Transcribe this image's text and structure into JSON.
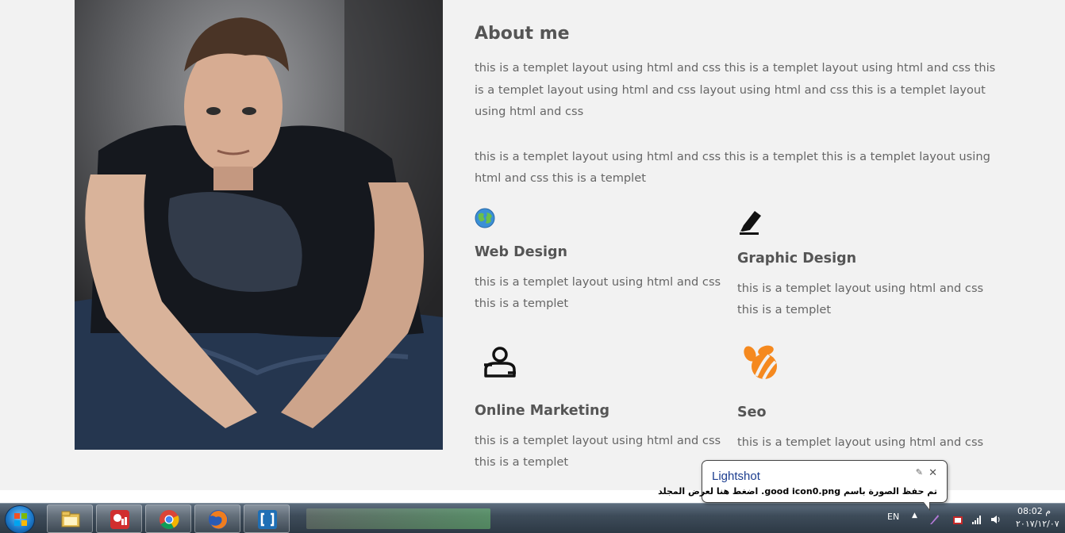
{
  "about": {
    "title": "About me",
    "paragraph1": "this is a templet layout using html and css this is a templet layout using html and css this is a templet layout using html and css layout using html and css this is a templet layout using html and css",
    "paragraph2": "this is a templet layout using html and css this is a templet this is a templet layout using html and css this is a templet"
  },
  "services": [
    {
      "title": "Web Design",
      "text": "this is a templet layout using html and css this is a templet",
      "icon": "globe-icon"
    },
    {
      "title": "Graphic Design",
      "text": "this is a templet layout using html and css this is a templet",
      "icon": "pencil-icon"
    },
    {
      "title": "Online Marketing",
      "text": "this is a templet layout using html and css this is a templet",
      "icon": "user-marketing-icon"
    },
    {
      "title": "Seo",
      "text": "this is a templet layout using html and css",
      "icon": "swarm-bee-icon"
    }
  ],
  "notification": {
    "title": "Lightshot",
    "message": "تم حفظ الصورة باسم good icon0.png. اضغط هنا لعرض المجلد"
  },
  "taskbar": {
    "apps": [
      "windows-explorer-icon",
      "wps-office-icon",
      "chrome-icon",
      "firefox-icon",
      "brackets-icon"
    ],
    "language": "EN",
    "time": "08:02 م",
    "date": "٢٠١٧/١٢/٠٧"
  },
  "colors": {
    "background": "#f2f2f2",
    "heading": "#555555",
    "body_text": "#666666",
    "seo_icon": "#f5891f",
    "notif_title": "#1c3d8f"
  }
}
